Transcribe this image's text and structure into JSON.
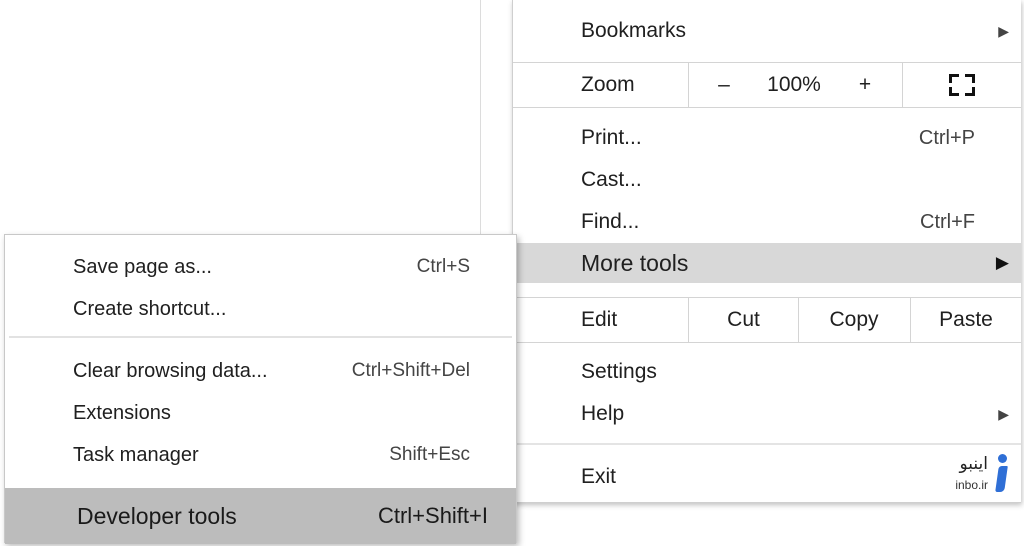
{
  "main_menu": {
    "bookmarks": "Bookmarks",
    "zoom": {
      "label": "Zoom",
      "minus": "–",
      "value": "100%",
      "plus": "+"
    },
    "print": {
      "label": "Print...",
      "shortcut": "Ctrl+P"
    },
    "cast": "Cast...",
    "find": {
      "label": "Find...",
      "shortcut": "Ctrl+F"
    },
    "more_tools": "More tools",
    "edit": {
      "label": "Edit",
      "cut": "Cut",
      "copy": "Copy",
      "paste": "Paste"
    },
    "settings": "Settings",
    "help": "Help",
    "exit": "Exit"
  },
  "sub_menu": {
    "save_page": {
      "label": "Save page as...",
      "shortcut": "Ctrl+S"
    },
    "create_shortcut": "Create shortcut...",
    "clear_data": {
      "label": "Clear browsing data...",
      "shortcut": "Ctrl+Shift+Del"
    },
    "extensions": "Extensions",
    "task_manager": {
      "label": "Task manager",
      "shortcut": "Shift+Esc"
    },
    "developer_tools": {
      "label": "Developer tools",
      "shortcut": "Ctrl+Shift+I"
    }
  },
  "watermark": {
    "text_fa": "اینبو",
    "text_en": "inbo.ir",
    "logo_icon": "info-i-icon"
  },
  "icons": {
    "submenu_arrow": "triangle-right-icon",
    "fullscreen": "fullscreen-icon"
  },
  "colors": {
    "highlight": "#d8d8d8",
    "sub_highlight": "#bcbcbc",
    "watermark_blue": "#2f6fd6"
  }
}
